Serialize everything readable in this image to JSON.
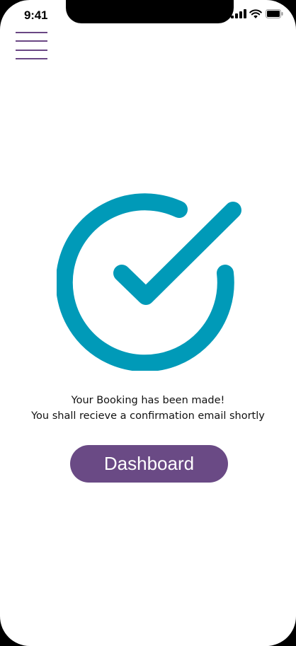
{
  "status_bar": {
    "time": "9:41",
    "icons": [
      "signal-icon",
      "wifi-icon",
      "battery-icon"
    ]
  },
  "header": {
    "menu_icon": "hamburger-menu-icon"
  },
  "confirmation": {
    "icon": "check-circle-icon",
    "icon_color": "#009ab8",
    "line1": "Your Booking has been made!",
    "line2": "You shall recieve a confirmation email shortly"
  },
  "actions": {
    "dashboard_label": "Dashboard",
    "button_color": "#6a4a85"
  }
}
